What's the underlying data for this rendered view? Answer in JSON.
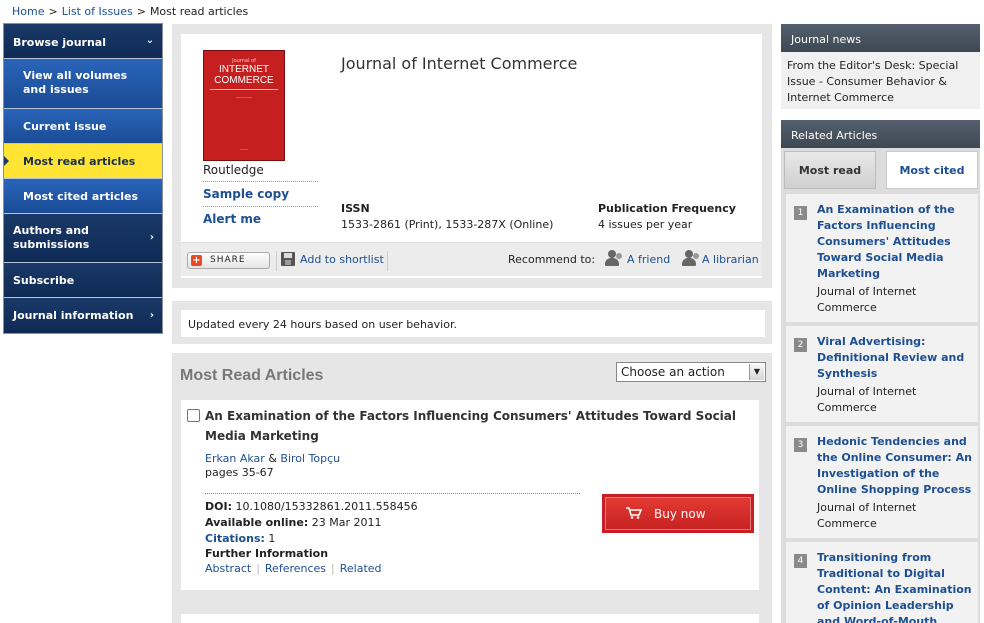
{
  "breadcrumb": {
    "items": [
      "Home",
      "List of Issues"
    ],
    "current": "Most read articles",
    "separator": ">"
  },
  "left_nav": {
    "items": [
      {
        "label": "Browse journal",
        "style": "dark",
        "chevron": "chevron-down"
      },
      {
        "label": "View all volumes and issues",
        "style": "sub"
      },
      {
        "label": "Current issue",
        "style": "sub"
      },
      {
        "label": "Most read articles",
        "style": "sub",
        "active": true
      },
      {
        "label": "Most cited articles",
        "style": "sub"
      },
      {
        "label": "Authors and submissions",
        "style": "dark",
        "chevron": "chevron-right"
      },
      {
        "label": "Subscribe",
        "style": "dark"
      },
      {
        "label": "Journal information",
        "style": "dark",
        "chevron": "chevron-right"
      }
    ]
  },
  "journal": {
    "title": "Journal of Internet Commerce",
    "cover_lines": [
      "Journal of",
      "INTERNET COMMERCE"
    ],
    "publisher": "Routledge",
    "sample_copy": "Sample copy",
    "alert_me": "Alert me",
    "issn_label": "ISSN",
    "issn_value": "1533-2861 (Print), 1533-287X (Online)",
    "frequency_label": "Publication Frequency",
    "frequency_value": "4 issues per year"
  },
  "toolbar": {
    "share_label": "SHARE",
    "shortlist_label": "Add to shortlist",
    "recommend_label": "Recommend to:",
    "friend_label": "A friend",
    "librarian_label": "A librarian"
  },
  "notice": {
    "text": "Updated every 24 hours based on user behavior."
  },
  "most_read": {
    "heading": "Most Read Articles",
    "action_select": "Choose an action",
    "article": {
      "title": "An Examination of the Factors Influencing Consumers' Attitudes Toward Social Media Marketing",
      "author1": "Erkan Akar",
      "author_join": "&",
      "author2": "Birol Topçu",
      "pages": "pages 35-67",
      "doi_label": "DOI:",
      "doi_value": "10.1080/15332861.2011.558456",
      "online_label": "Available online:",
      "online_value": "23 Mar 2011",
      "citations_label": "Citations:",
      "citations_value": "1",
      "further_label": "Further Information",
      "links": [
        "Abstract",
        "References",
        "Related"
      ],
      "buy_label": "Buy now"
    }
  },
  "journal_news": {
    "heading": "Journal news",
    "text": "From the Editor's Desk: Special Issue - Consumer Behavior & Internet Commerce"
  },
  "related_articles": {
    "heading": "Related Articles",
    "tabs": [
      "Most read",
      "Most cited"
    ],
    "items": [
      {
        "num": "1",
        "title": "An Examination of the Factors Influencing Consumers' Attitudes Toward Social Media Marketing",
        "source": "Journal of Internet Commerce"
      },
      {
        "num": "2",
        "title": "Viral Advertising: Definitional Review and Synthesis",
        "source": "Journal of Internet Commerce"
      },
      {
        "num": "3",
        "title": "Hedonic Tendencies and the Online Consumer: An Investigation of the Online Shopping Process",
        "source": "Journal of Internet Commerce"
      },
      {
        "num": "4",
        "title": "Transitioning from Traditional to Digital Content: An Examination of Opinion Leadership and Word-of-Mouth",
        "source": ""
      }
    ]
  },
  "colors": {
    "link": "#1d4f91",
    "nav_dark": "#0f2a55",
    "nav_sub": "#1a4c96",
    "nav_active": "#ffe433",
    "buy": "#c81f24",
    "cover": "#c5201f"
  }
}
